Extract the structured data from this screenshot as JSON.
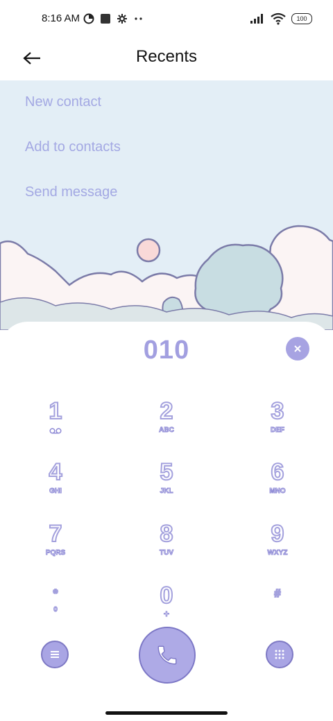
{
  "status": {
    "time": "8:16 AM",
    "battery": "100",
    "left_icons": [
      "data-saver-icon",
      "square-notification-icon",
      "gear-icon",
      "more-dots-icon"
    ],
    "right_icons": [
      "signal-icon",
      "wifi-icon",
      "battery-icon"
    ]
  },
  "app_bar": {
    "title": "Recents"
  },
  "actions": {
    "new_contact": "New contact",
    "add_to_contacts": "Add to contacts",
    "send_message": "Send message"
  },
  "dialer": {
    "number": "010",
    "keys": [
      {
        "digit": "1",
        "letters": ""
      },
      {
        "digit": "2",
        "letters": "ABC"
      },
      {
        "digit": "3",
        "letters": "DEF"
      },
      {
        "digit": "4",
        "letters": "GHI"
      },
      {
        "digit": "5",
        "letters": "JKL"
      },
      {
        "digit": "6",
        "letters": "MNO"
      },
      {
        "digit": "7",
        "letters": "PQRS"
      },
      {
        "digit": "8",
        "letters": "TUV"
      },
      {
        "digit": "9",
        "letters": "WXYZ"
      },
      {
        "digit": "*",
        "letters": "0"
      },
      {
        "digit": "0",
        "letters": "+"
      },
      {
        "digit": "#",
        "letters": ""
      }
    ]
  },
  "colors": {
    "accent": "#a7a3e2",
    "sky": "#e3eef6",
    "action_text": "#a3a8e3"
  }
}
